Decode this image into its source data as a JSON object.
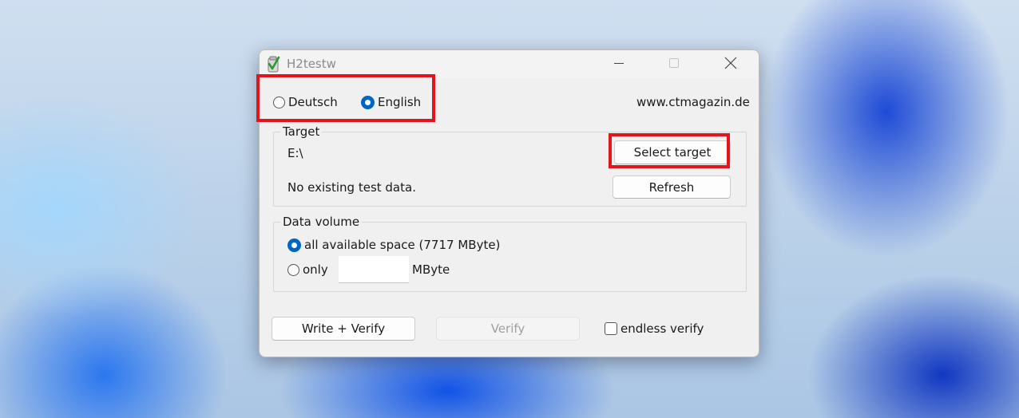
{
  "window": {
    "title": "H2testw",
    "controls": {
      "minimize": "minimize",
      "maximize": "maximize",
      "close": "close"
    }
  },
  "language": {
    "options": [
      {
        "label": "Deutsch",
        "selected": false
      },
      {
        "label": "English",
        "selected": true
      }
    ],
    "website": "www.ctmagazin.de"
  },
  "target": {
    "group_label": "Target",
    "path": "E:\\",
    "status": "No existing test data.",
    "select_button": "Select target",
    "refresh_button": "Refresh"
  },
  "data_volume": {
    "group_label": "Data volume",
    "all_space_label": "all available space (7717 MByte)",
    "all_space_selected": true,
    "only_label": "only",
    "only_selected": false,
    "only_value": "",
    "unit_label": "MByte"
  },
  "actions": {
    "write_verify_button": "Write + Verify",
    "verify_button": "Verify",
    "verify_disabled": true,
    "endless_verify_label": "endless verify",
    "endless_verify_checked": false
  },
  "annotations": {
    "highlight_color": "#e3141c"
  },
  "colors": {
    "radio_selected": "#0066c4",
    "window_background": "#f0f0f0"
  }
}
